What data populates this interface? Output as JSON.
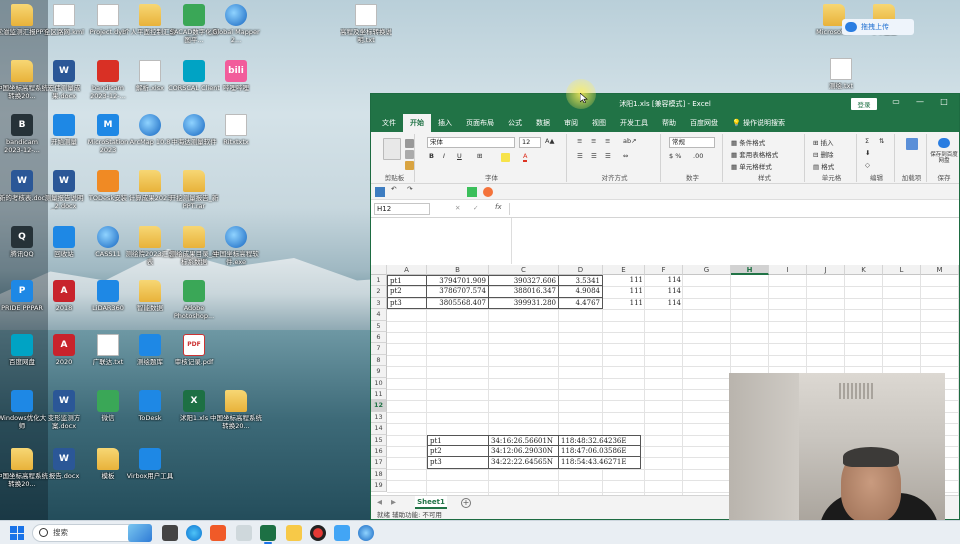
{
  "desktop": {
    "icons": [
      {
        "label": "松滋监测汇报PPT",
        "glyph": "",
        "kind": "folder"
      },
      {
        "label": "中国坐标高程系统转换20...",
        "glyph": "",
        "kind": "folder"
      },
      {
        "label": "bandicam 2023-12-...",
        "glyph": "B",
        "kind": "dark"
      },
      {
        "label": "新的考核表.doc",
        "glyph": "W",
        "kind": "word"
      },
      {
        "label": "腾讯QQ",
        "glyph": "Q",
        "kind": "dark"
      },
      {
        "label": "PRIDE PPPAR",
        "glyph": "P",
        "kind": "blue"
      },
      {
        "label": "百度网盘",
        "glyph": "",
        "kind": "cyan"
      },
      {
        "label": "Windows优化大师",
        "glyph": "",
        "kind": "blue"
      },
      {
        "label": "中国坐标高程系统转换20...",
        "glyph": "",
        "kind": "folder"
      },
      {
        "label": "全区路网.kml",
        "glyph": "",
        "kind": "doc"
      },
      {
        "label": "宏伟测量成果.docx",
        "glyph": "W",
        "kind": "word"
      },
      {
        "label": "开始测量",
        "glyph": "",
        "kind": "blue"
      },
      {
        "label": "测量报告说明_2.docx",
        "glyph": "W",
        "kind": "word"
      },
      {
        "label": "回收站",
        "glyph": "",
        "kind": "blue"
      },
      {
        "label": "2018",
        "glyph": "A",
        "kind": "acad"
      },
      {
        "label": "2020",
        "glyph": "A",
        "kind": "acad"
      },
      {
        "label": "变形监测方案.docx",
        "glyph": "W",
        "kind": "word"
      },
      {
        "label": "报告.docx",
        "glyph": "W",
        "kind": "word"
      },
      {
        "label": "Project.dyb",
        "glyph": "DYB",
        "kind": "doc"
      },
      {
        "label": "bandicam 2023-12-...",
        "glyph": "",
        "kind": "red"
      },
      {
        "label": "MicroStation 2023",
        "glyph": "M",
        "kind": "blue"
      },
      {
        "label": "TODesk安装",
        "glyph": "",
        "kind": "orange"
      },
      {
        "label": "CASS11",
        "glyph": "",
        "kind": "globe"
      },
      {
        "label": "LiDAR360",
        "glyph": "",
        "kind": "blue"
      },
      {
        "label": "广联达.txt",
        "glyph": "",
        "kind": "doc"
      },
      {
        "label": "微信",
        "glyph": "",
        "kind": "green"
      },
      {
        "label": "模板",
        "glyph": "",
        "kind": "folder"
      },
      {
        "label": "个人平面控制汇总",
        "glyph": "",
        "kind": "folder"
      },
      {
        "label": "解析.xlsx",
        "glyph": "",
        "kind": "doc"
      },
      {
        "label": "ArcMap 10.8",
        "glyph": "",
        "kind": "globe"
      },
      {
        "label": "计算成果2023",
        "glyph": "",
        "kind": "folder"
      },
      {
        "label": "测绘院2023汇总表",
        "glyph": "",
        "kind": "folder"
      },
      {
        "label": "智能数据",
        "glyph": "",
        "kind": "folder"
      },
      {
        "label": "测绘题库",
        "glyph": "",
        "kind": "blue"
      },
      {
        "label": "ToDesk",
        "glyph": "",
        "kind": "blue"
      },
      {
        "label": "Virbox用户工具",
        "glyph": "",
        "kind": "blue"
      },
      {
        "label": "SACAD数字化测图平...",
        "glyph": "",
        "kind": "green"
      },
      {
        "label": "CORSCAL Client",
        "glyph": "",
        "kind": "cyan"
      },
      {
        "label": "中海达测量软件",
        "glyph": "",
        "kind": "globe"
      },
      {
        "label": "开挖测量报告_新PPT.rar",
        "glyph": "",
        "kind": "folder"
      },
      {
        "label": "测绘成果目录_坐标系数据",
        "glyph": "",
        "kind": "folder"
      },
      {
        "label": "Adobe Photoshop...",
        "glyph": "",
        "kind": "green"
      },
      {
        "label": "审核记录.pdf",
        "glyph": "PDF",
        "kind": "pdf"
      },
      {
        "label": "沭阳1.xls",
        "glyph": "X",
        "kind": "excel"
      },
      {
        "label": "Global Mapper 2...",
        "glyph": "",
        "kind": "globe"
      },
      {
        "label": "哔哩哔哩",
        "glyph": "bili",
        "kind": "pink"
      },
      {
        "label": "Ritxtxtx",
        "glyph": "",
        "kind": "doc"
      },
      {
        "label": "中国坐标高程软件.exe",
        "glyph": "",
        "kind": "globe"
      },
      {
        "label": "中国坐标高程系统转换20...",
        "glyph": "",
        "kind": "folder"
      },
      {
        "label": "高程及坐标转换说明.txt",
        "glyph": "",
        "kind": "doc"
      },
      {
        "label": "Microsoft...",
        "glyph": "",
        "kind": "folder"
      },
      {
        "label": "中平报告",
        "glyph": "",
        "kind": "folder"
      },
      {
        "label": "测绘.txt",
        "glyph": "",
        "kind": "doc"
      }
    ],
    "baidu_badge": "拖拽上传"
  },
  "excel": {
    "title": "沭阳1.xls [兼容模式] - Excel",
    "login": "登录",
    "tabs": [
      "文件",
      "开始",
      "插入",
      "页面布局",
      "公式",
      "数据",
      "审阅",
      "视图",
      "开发工具",
      "帮助",
      "百度网盘"
    ],
    "tell_me": "操作说明搜索",
    "ribbon": {
      "font_name": "宋体",
      "font_size": "12",
      "number_format": "常规",
      "groups": [
        "剪贴板",
        "字体",
        "对齐方式",
        "数字",
        "样式",
        "单元格",
        "编辑",
        "加载项",
        "保存"
      ],
      "styles": [
        "条件格式",
        "套用表格格式",
        "单元格样式"
      ],
      "cells": [
        "插入",
        "删除",
        "格式"
      ],
      "save_label": "保存到百度网盘",
      "addins": "加载项"
    },
    "name_box": "H12",
    "columns": [
      "A",
      "B",
      "C",
      "D",
      "E",
      "F",
      "G",
      "H",
      "I",
      "J",
      "K",
      "L",
      "M"
    ],
    "selected_column": "H",
    "rows": [
      "1",
      "2",
      "3",
      "4",
      "5",
      "6",
      "7",
      "8",
      "9",
      "10",
      "11",
      "12",
      "13",
      "14",
      "15",
      "16",
      "17",
      "18",
      "19"
    ],
    "selected_row": "12",
    "table1": [
      [
        "pt1",
        "3794701.909",
        "390327.606",
        "3.5341",
        "111",
        "114"
      ],
      [
        "pt2",
        "3786707.574",
        "388016.347",
        "4.9084",
        "111",
        "114"
      ],
      [
        "pt3",
        "3805568.407",
        "399931.280",
        "4.4767",
        "111",
        "114"
      ]
    ],
    "table2": [
      [
        "pt1",
        "34:16:26.56601N",
        "118:48:32.64236E"
      ],
      [
        "pt2",
        "34:12:06.29030N",
        "118:47:06.03586E"
      ],
      [
        "pt3",
        "34:22:22.64565N",
        "118:54:43.46271E"
      ]
    ],
    "sheet_tab": "Sheet1",
    "status": "就绪    辅助功能: 不可用"
  },
  "taskbar": {
    "search_placeholder": "搜索"
  }
}
